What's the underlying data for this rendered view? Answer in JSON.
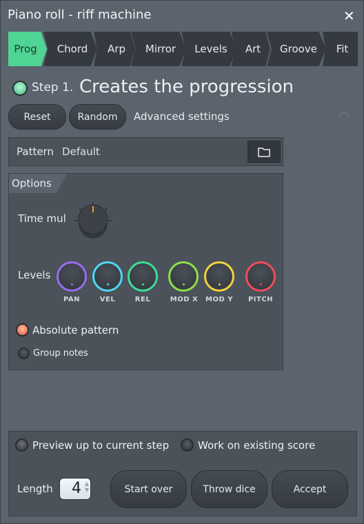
{
  "window": {
    "title": "Piano roll - riff machine",
    "close_icon": "close-icon"
  },
  "tabs": [
    {
      "label": "Prog",
      "active": true
    },
    {
      "label": "Chord"
    },
    {
      "label": "Arp"
    },
    {
      "label": "Mirror"
    },
    {
      "label": "Levels"
    },
    {
      "label": "Art"
    },
    {
      "label": "Groove"
    },
    {
      "label": "Fit"
    }
  ],
  "step": {
    "number": "Step 1.",
    "description": "Creates the progression"
  },
  "toolbar": {
    "reset": "Reset",
    "random": "Random",
    "advanced": "Advanced settings"
  },
  "pattern": {
    "label": "Pattern",
    "value": "Default"
  },
  "options": {
    "title": "Options",
    "time_mul": "Time mul",
    "levels": "Levels",
    "knobs": [
      {
        "label": "PAN",
        "color": "#9a6cf0"
      },
      {
        "label": "VEL",
        "color": "#4fd8f4"
      },
      {
        "label": "REL",
        "color": "#3fdc9a"
      },
      {
        "label": "MOD X",
        "color": "#8ee04a"
      },
      {
        "label": "MOD Y",
        "color": "#f4d23c"
      },
      {
        "label": "PITCH",
        "color": "#f04d5c"
      }
    ],
    "absolute_pattern": "Absolute pattern",
    "group_notes": "Group notes"
  },
  "footer": {
    "preview": "Preview up to current step",
    "work_existing": "Work on existing score",
    "length_label": "Length",
    "length_value": "4",
    "start_over": "Start over",
    "throw_dice": "Throw dice",
    "accept": "Accept"
  },
  "colors": {
    "accent": "#4fd494",
    "time_mul_indicator": "#f0a020",
    "absolute_led": "#f06a4a"
  }
}
